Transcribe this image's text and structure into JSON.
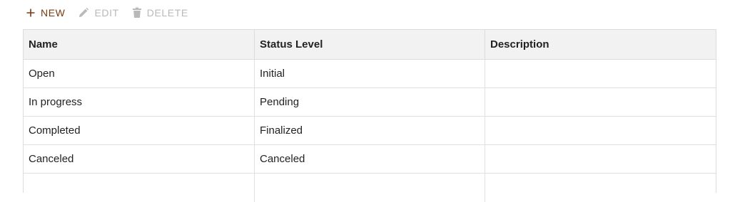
{
  "toolbar": {
    "new_label": "NEW",
    "edit_label": "EDIT",
    "delete_label": "DELETE",
    "new_icon": "plus-icon",
    "edit_icon": "pencil-icon",
    "delete_icon": "trash-icon",
    "accent_color": "#7a3a10",
    "disabled_color": "#b9b9b9"
  },
  "table": {
    "columns": [
      "Name",
      "Status Level",
      "Description"
    ],
    "rows": [
      [
        "Open",
        "Initial",
        ""
      ],
      [
        "In progress",
        "Pending",
        ""
      ],
      [
        "Completed",
        "Finalized",
        ""
      ],
      [
        "Canceled",
        "Canceled",
        ""
      ]
    ]
  }
}
